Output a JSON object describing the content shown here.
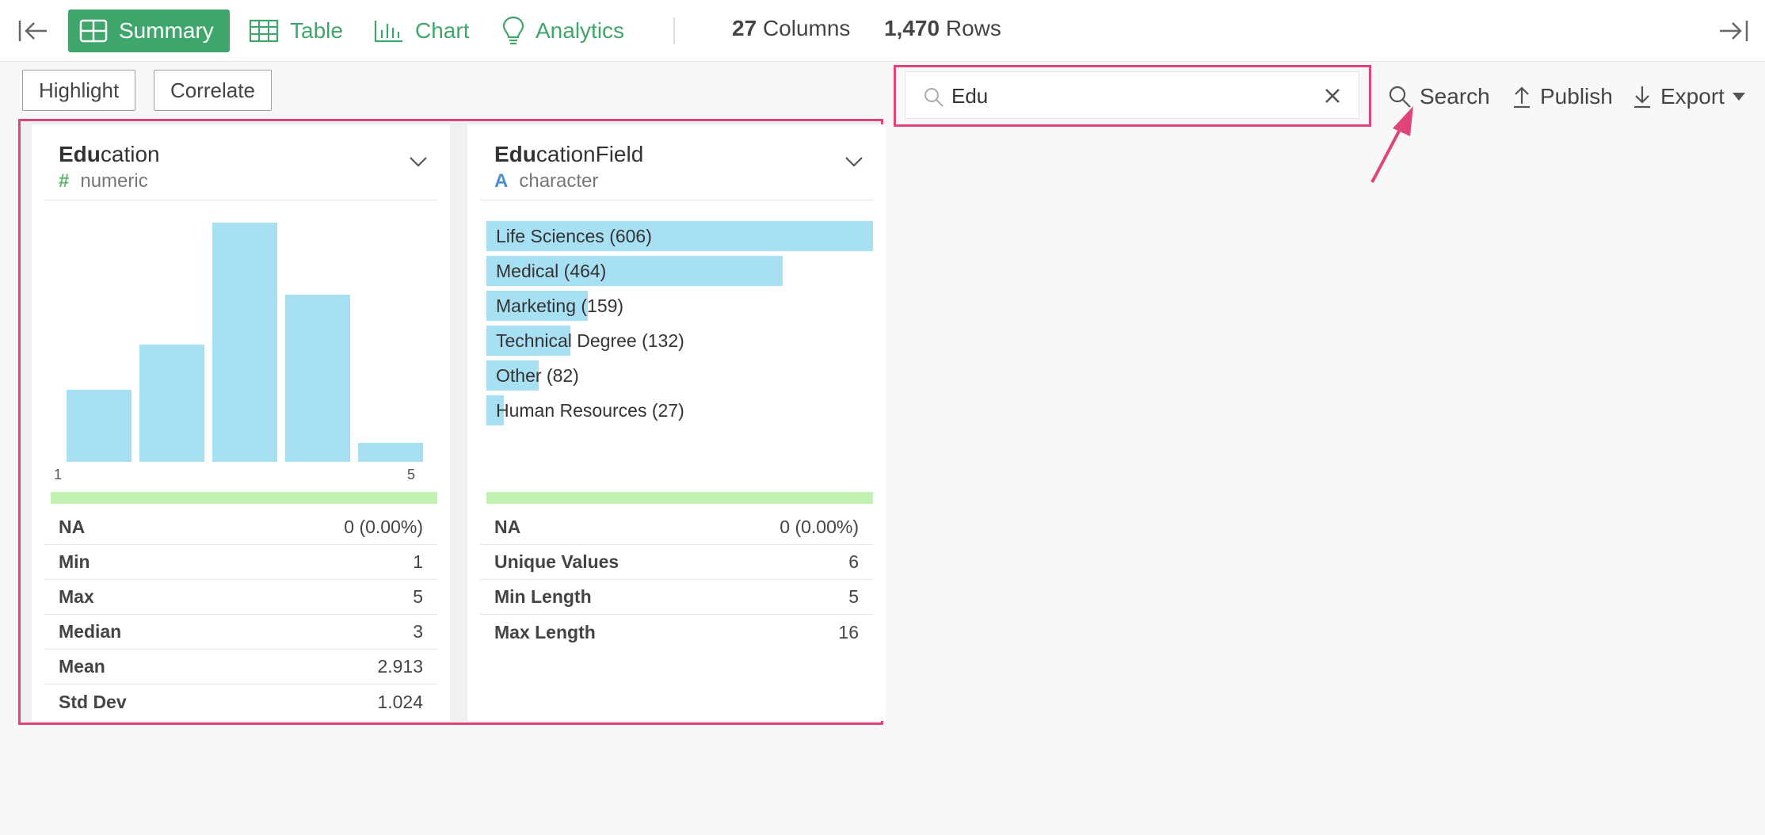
{
  "toolbar": {
    "tabs": [
      {
        "label": "Summary",
        "icon": "grid-icon",
        "active": true
      },
      {
        "label": "Table",
        "icon": "table-icon",
        "active": false
      },
      {
        "label": "Chart",
        "icon": "bar-chart-icon",
        "active": false
      },
      {
        "label": "Analytics",
        "icon": "lightbulb-icon",
        "active": false
      }
    ],
    "columns_count": "27",
    "columns_label": "Columns",
    "rows_count": "1,470",
    "rows_label": "Rows"
  },
  "actions": {
    "highlight_label": "Highlight",
    "correlate_label": "Correlate",
    "search_value": "Edu",
    "search_label": "Search",
    "publish_label": "Publish",
    "export_label": "Export"
  },
  "colors": {
    "accent": "#3ea66a",
    "highlight_border": "#e04478",
    "bar": "#a8e0f3",
    "na_strip": "#c1f1b0"
  },
  "cards": [
    {
      "title_match": "Edu",
      "title_rest": "cation",
      "type_glyph": "#",
      "type": "numeric",
      "chart_data": {
        "type": "bar",
        "x_range": [
          "1",
          "5"
        ],
        "values": [
          0.3,
          0.49,
          1.0,
          0.7,
          0.08
        ],
        "note_values": "relative heights"
      },
      "stats": [
        {
          "label": "NA",
          "value": "0 (0.00%)"
        },
        {
          "label": "Min",
          "value": "1"
        },
        {
          "label": "Max",
          "value": "5"
        },
        {
          "label": "Median",
          "value": "3"
        },
        {
          "label": "Mean",
          "value": "2.913"
        },
        {
          "label": "Std Dev",
          "value": "1.024"
        }
      ]
    },
    {
      "title_match": "Edu",
      "title_rest": "cationField",
      "type_glyph": "A",
      "type": "character",
      "categories": [
        {
          "label": "Life Sciences (606)",
          "count": 606
        },
        {
          "label": "Medical (464)",
          "count": 464
        },
        {
          "label": "Marketing (159)",
          "count": 159
        },
        {
          "label": "Technical Degree (132)",
          "count": 132
        },
        {
          "label": "Other (82)",
          "count": 82
        },
        {
          "label": "Human Resources (27)",
          "count": 27
        }
      ],
      "stats": [
        {
          "label": "NA",
          "value": "0 (0.00%)"
        },
        {
          "label": "Unique Values",
          "value": "6"
        },
        {
          "label": "Min Length",
          "value": "5"
        },
        {
          "label": "Max Length",
          "value": "16"
        }
      ]
    }
  ]
}
